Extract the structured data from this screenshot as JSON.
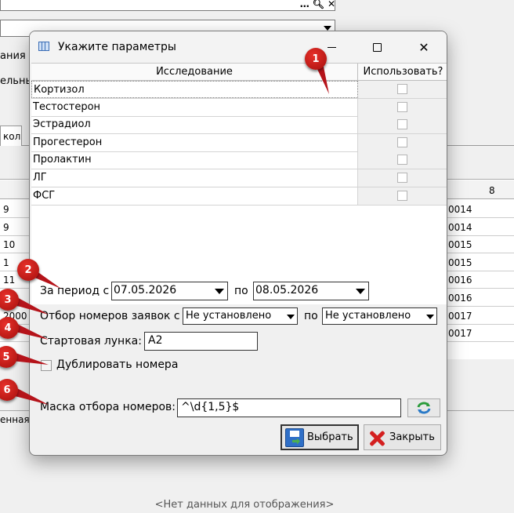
{
  "background": {
    "top_icons": [
      "…",
      "search-icon",
      "close-icon"
    ],
    "left_labels": [
      "ания",
      "ельны"
    ],
    "tab_label": "кол",
    "grid_col_header": "8",
    "grid_rows": [
      {
        "left": "9",
        "right": "0014"
      },
      {
        "left": "9",
        "right": "0014"
      },
      {
        "left": "10",
        "right": "0015"
      },
      {
        "left": "1",
        "right": "0015"
      },
      {
        "left": "11",
        "right": "0016"
      },
      {
        "left": "",
        "right": "0016"
      },
      {
        "left": "2000",
        "right": "0017"
      },
      {
        "left": "",
        "right": "0017"
      }
    ],
    "bottom_left_text": "енная",
    "empty_message": "<Нет данных для отображения>"
  },
  "dialog": {
    "title": "Укажите параметры",
    "table": {
      "columns": [
        "Исследование",
        "Использовать?"
      ],
      "rows": [
        {
          "name": "Кортизол",
          "checked": false
        },
        {
          "name": "Тестостерон",
          "checked": false
        },
        {
          "name": "Эстрадиол",
          "checked": false
        },
        {
          "name": "Прогестерон",
          "checked": false
        },
        {
          "name": "Пролактин",
          "checked": false
        },
        {
          "name": "ЛГ",
          "checked": false
        },
        {
          "name": "ФСГ",
          "checked": false
        }
      ]
    },
    "period": {
      "label": "За период с",
      "from": "07.05.2026",
      "to_label": "по",
      "to": "08.05.2026"
    },
    "orders": {
      "label": "Отбор номеров заявок с",
      "from": "Не установлено",
      "to_label": "по",
      "to": "Не установлено"
    },
    "start_well": {
      "label": "Стартовая лунка:",
      "value": "A2"
    },
    "duplicate": {
      "label": "Дублировать номера",
      "checked": false
    },
    "mask": {
      "label": "Маска отбора номеров:",
      "value": "^\\d{1,5}$"
    },
    "buttons": {
      "select": "Выбрать",
      "close": "Закрыть"
    }
  },
  "annotations": [
    "1",
    "2",
    "3",
    "4",
    "5",
    "6"
  ],
  "colors": {
    "badge": "#c8161d"
  }
}
